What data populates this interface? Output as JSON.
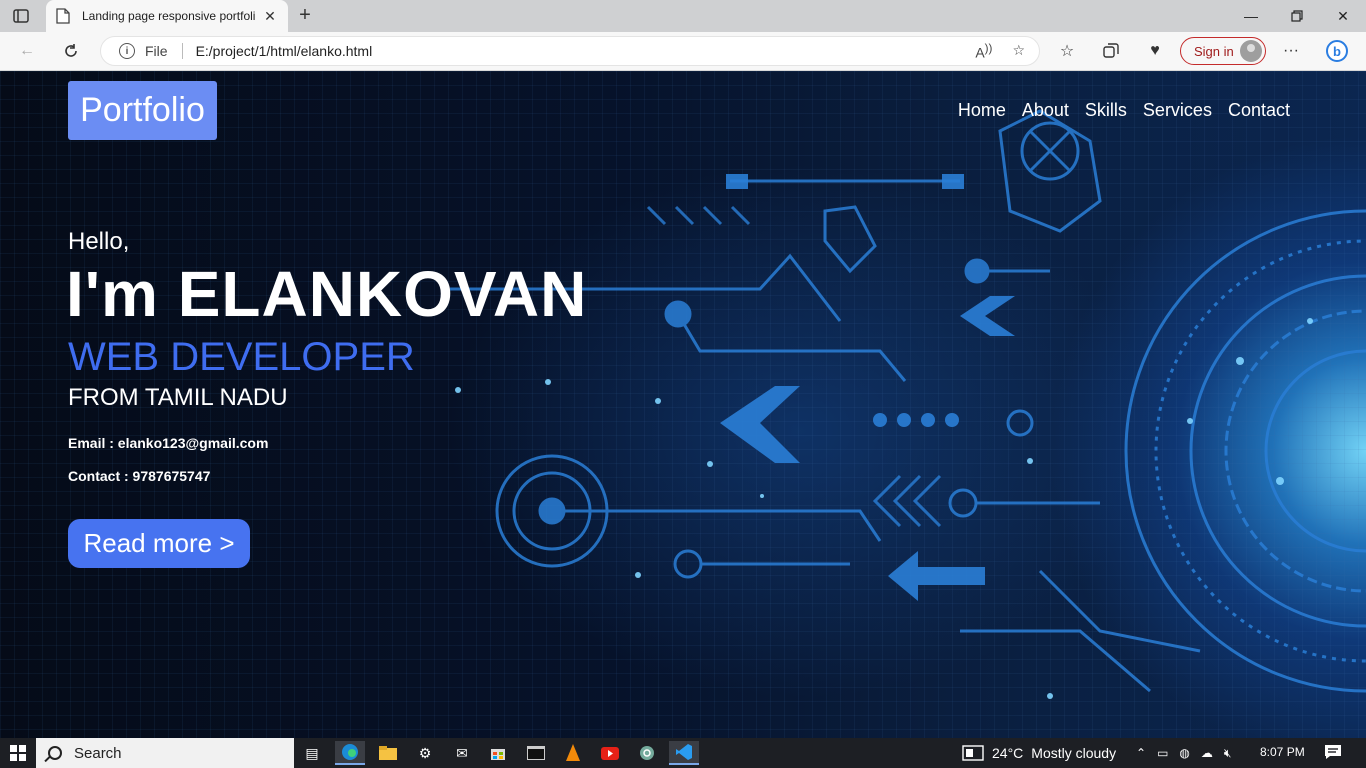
{
  "browser": {
    "tab_title": "Landing page responsive portfoli",
    "address_prefix": "File",
    "url": "E:/project/1/html/elanko.html",
    "sign_in": "Sign in"
  },
  "site": {
    "logo": "Portfolio",
    "nav": [
      "Home",
      "About",
      "Skills",
      "Services",
      "Contact"
    ],
    "greeting": "Hello,",
    "name": "I'm ELANKOVAN",
    "role": "WEB DEVELOPER",
    "location": "FROM TAMIL NADU",
    "email": "Email : elanko123@gmail.com",
    "contact": "Contact : 9787675747",
    "cta": "Read more >"
  },
  "taskbar": {
    "search": "Search",
    "weather_temp": "24°C",
    "weather_desc": "Mostly cloudy",
    "time": "8:07 PM"
  },
  "colors": {
    "accent": "#4773f0",
    "logo_bg": "#6b8df3",
    "role_text": "#3f6df0",
    "signin_border": "#c42b2b"
  }
}
